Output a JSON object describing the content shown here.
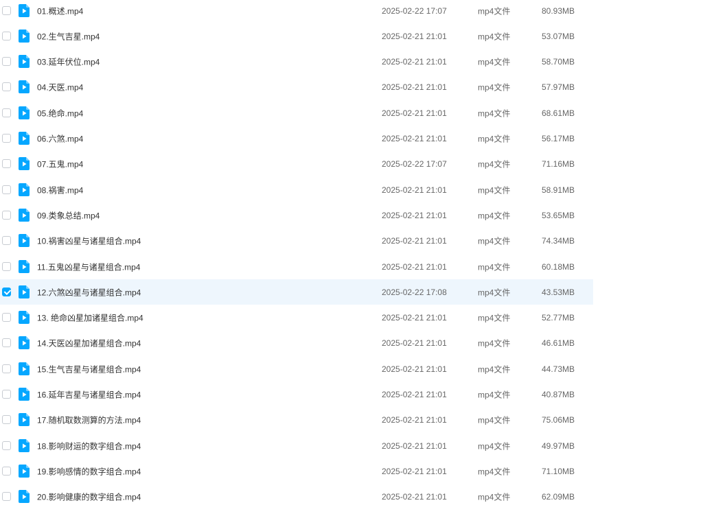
{
  "accent_color": "#06a7ff",
  "selected_row_color": "#eef6fd",
  "file_icon": "video-file-icon",
  "files": [
    {
      "name": "01.概述.mp4",
      "date": "2025-02-22 17:07",
      "type": "mp4文件",
      "size": "80.93MB",
      "selected": false
    },
    {
      "name": "02.生气吉星.mp4",
      "date": "2025-02-21 21:01",
      "type": "mp4文件",
      "size": "53.07MB",
      "selected": false
    },
    {
      "name": "03.延年伏位.mp4",
      "date": "2025-02-21 21:01",
      "type": "mp4文件",
      "size": "58.70MB",
      "selected": false
    },
    {
      "name": "04.天医.mp4",
      "date": "2025-02-21 21:01",
      "type": "mp4文件",
      "size": "57.97MB",
      "selected": false
    },
    {
      "name": "05.绝命.mp4",
      "date": "2025-02-21 21:01",
      "type": "mp4文件",
      "size": "68.61MB",
      "selected": false
    },
    {
      "name": "06.六煞.mp4",
      "date": "2025-02-21 21:01",
      "type": "mp4文件",
      "size": "56.17MB",
      "selected": false
    },
    {
      "name": "07.五鬼.mp4",
      "date": "2025-02-22 17:07",
      "type": "mp4文件",
      "size": "71.16MB",
      "selected": false
    },
    {
      "name": "08.祸害.mp4",
      "date": "2025-02-21 21:01",
      "type": "mp4文件",
      "size": "58.91MB",
      "selected": false
    },
    {
      "name": "09.类象总结.mp4",
      "date": "2025-02-21 21:01",
      "type": "mp4文件",
      "size": "53.65MB",
      "selected": false
    },
    {
      "name": "10.祸害凶星与诸星组合.mp4",
      "date": "2025-02-21 21:01",
      "type": "mp4文件",
      "size": "74.34MB",
      "selected": false
    },
    {
      "name": "11.五鬼凶星与诸星组合.mp4",
      "date": "2025-02-21 21:01",
      "type": "mp4文件",
      "size": "60.18MB",
      "selected": false
    },
    {
      "name": "12.六煞凶星与诸星组合.mp4",
      "date": "2025-02-22 17:08",
      "type": "mp4文件",
      "size": "43.53MB",
      "selected": true
    },
    {
      "name": "13. 绝命凶星加诸星组合.mp4",
      "date": "2025-02-21 21:01",
      "type": "mp4文件",
      "size": "52.77MB",
      "selected": false
    },
    {
      "name": "14.天医凶星加诸星组合.mp4",
      "date": "2025-02-21 21:01",
      "type": "mp4文件",
      "size": "46.61MB",
      "selected": false
    },
    {
      "name": "15.生气吉星与诸星组合.mp4",
      "date": "2025-02-21 21:01",
      "type": "mp4文件",
      "size": "44.73MB",
      "selected": false
    },
    {
      "name": "16.延年吉星与诸星组合.mp4",
      "date": "2025-02-21 21:01",
      "type": "mp4文件",
      "size": "40.87MB",
      "selected": false
    },
    {
      "name": "17.随机取数测算的方法.mp4",
      "date": "2025-02-21 21:01",
      "type": "mp4文件",
      "size": "75.06MB",
      "selected": false
    },
    {
      "name": "18.影响财运的数字组合.mp4",
      "date": "2025-02-21 21:01",
      "type": "mp4文件",
      "size": "49.97MB",
      "selected": false
    },
    {
      "name": "19.影响感情的数字组合.mp4",
      "date": "2025-02-21 21:01",
      "type": "mp4文件",
      "size": "71.10MB",
      "selected": false
    },
    {
      "name": "20.影响健康的数字组合.mp4",
      "date": "2025-02-21 21:01",
      "type": "mp4文件",
      "size": "62.09MB",
      "selected": false
    }
  ]
}
